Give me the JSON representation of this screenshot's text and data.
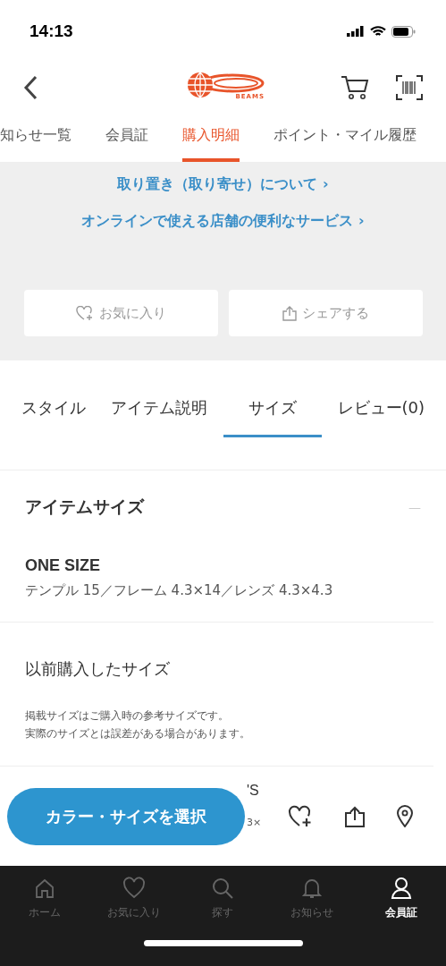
{
  "status_bar": {
    "time": "14:13"
  },
  "header": {
    "logo_text": "BEAMS"
  },
  "top_tabs": [
    {
      "label": "知らせ一覧",
      "selected": false
    },
    {
      "label": "会員証",
      "selected": false
    },
    {
      "label": "購入明細",
      "selected": true
    },
    {
      "label": "ポイント・マイル履歴",
      "selected": false
    }
  ],
  "links": [
    "取り置き（取り寄せ）について ›",
    "オンラインで使える店舗の便利なサービス ›"
  ],
  "action_buttons": [
    {
      "kind": "favorite",
      "label": "お気に入り"
    },
    {
      "kind": "share",
      "label": "シェアする"
    }
  ],
  "detail_tabs": [
    {
      "label": "スタイル",
      "selected": false
    },
    {
      "label": "アイテム説明",
      "selected": false
    },
    {
      "label": "サイズ",
      "selected": true
    },
    {
      "label": "レビュー(0)",
      "selected": false
    }
  ],
  "size_section": {
    "title": "アイテムサイズ",
    "collapse": "—",
    "size_name": "ONE SIZE",
    "measurements": "テンプル 15／フレーム 4.3×14／レンズ 4.3×4.3"
  },
  "previous_size": {
    "title": "以前購入したサイズ",
    "notes": [
      "掲載サイズはご購入時の参考サイズです。",
      "実際のサイズとは誤差がある場合があります。"
    ]
  },
  "partial_row": {
    "title": "'S",
    "text": "3×"
  },
  "select_button": "カラー・サイズを選択",
  "bottom_nav": [
    {
      "kind": "home",
      "label": "ホーム",
      "selected": false
    },
    {
      "kind": "heart",
      "label": "お気に入り",
      "selected": false
    },
    {
      "kind": "search",
      "label": "探す",
      "selected": false
    },
    {
      "kind": "bell",
      "label": "お知らせ",
      "selected": false
    },
    {
      "kind": "person",
      "label": "会員証",
      "selected": true
    }
  ]
}
